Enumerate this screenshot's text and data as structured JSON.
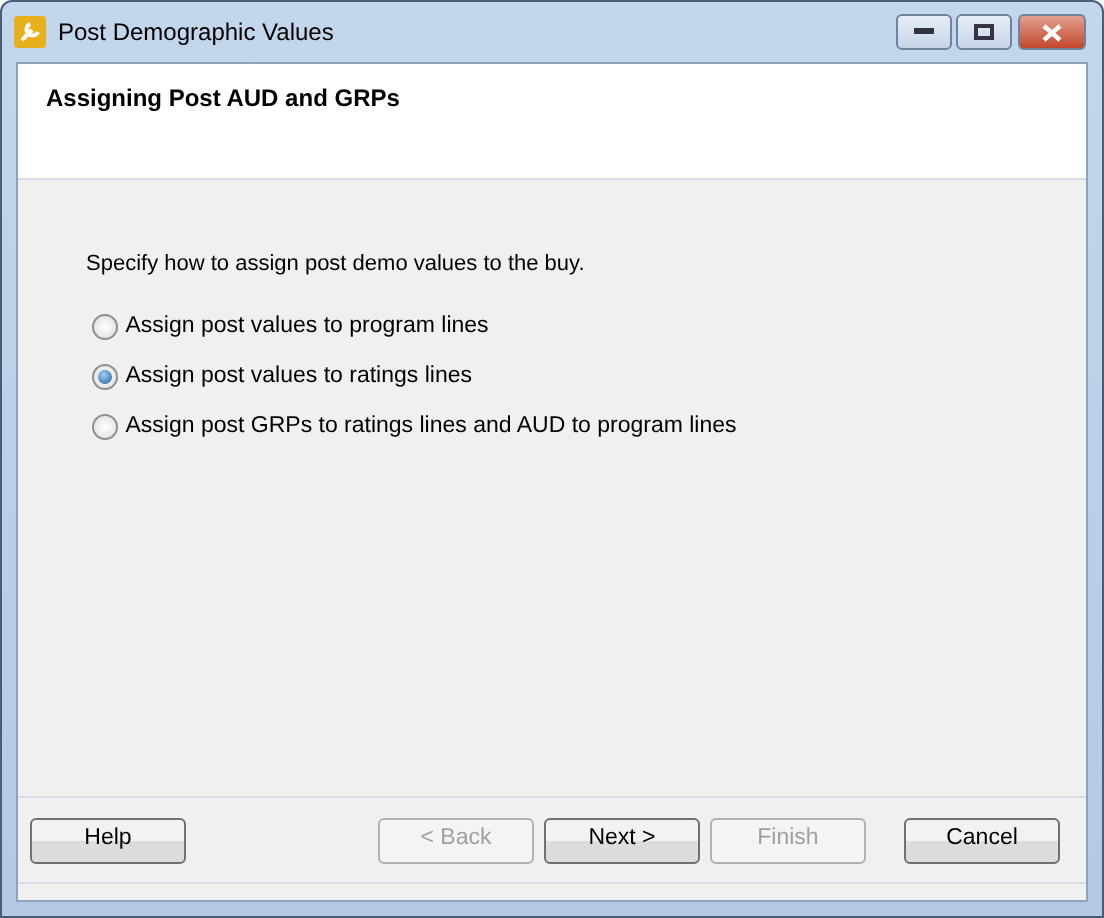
{
  "window": {
    "title": "Post Demographic Values"
  },
  "header": {
    "title": "Assigning Post AUD and GRPs"
  },
  "instruction": "Specify how to assign post demo values to the buy.",
  "options": [
    {
      "label": "Assign post values to program lines",
      "selected": false
    },
    {
      "label": "Assign post values to ratings lines",
      "selected": true
    },
    {
      "label": "Assign post GRPs to ratings lines and AUD to program lines",
      "selected": false
    }
  ],
  "buttons": [
    {
      "label": "Help",
      "kind": "help",
      "disabled": false
    },
    {
      "label": "< Back",
      "kind": "nav",
      "disabled": true
    },
    {
      "label": "Next >",
      "kind": "nav",
      "disabled": false
    },
    {
      "label": "Finish",
      "kind": "nav",
      "disabled": true
    },
    {
      "label": "Cancel",
      "kind": "cancel",
      "disabled": false
    }
  ]
}
